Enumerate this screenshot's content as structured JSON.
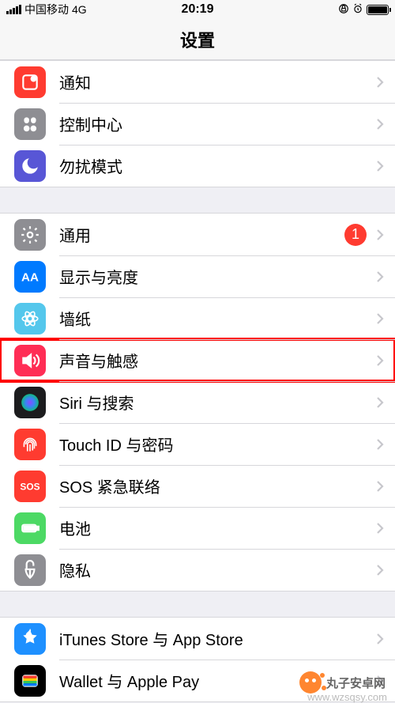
{
  "status": {
    "carrier": "中国移动",
    "network": "4G",
    "time": "20:19"
  },
  "header": {
    "title": "设置"
  },
  "groups": [
    [
      {
        "key": "notifications",
        "label": "通知",
        "bg": "#ff3b30",
        "iconFg": "#fff"
      },
      {
        "key": "control-center",
        "label": "控制中心",
        "bg": "#8e8e93",
        "iconFg": "#fff"
      },
      {
        "key": "dnd",
        "label": "勿扰模式",
        "bg": "#5856d6",
        "iconFg": "#fff"
      }
    ],
    [
      {
        "key": "general",
        "label": "通用",
        "bg": "#8e8e93",
        "iconFg": "#fff",
        "badge": "1"
      },
      {
        "key": "display",
        "label": "显示与亮度",
        "bg": "#007aff",
        "iconFg": "#fff"
      },
      {
        "key": "wallpaper",
        "label": "墙纸",
        "bg": "#54c7ec",
        "iconFg": "#fff"
      },
      {
        "key": "sounds",
        "label": "声音与触感",
        "bg": "#ff2d55",
        "iconFg": "#fff",
        "highlight": true
      },
      {
        "key": "siri",
        "label": "Siri 与搜索",
        "bg": "#1c1c1e",
        "iconFg": "#fff"
      },
      {
        "key": "touchid",
        "label": "Touch ID 与密码",
        "bg": "#ff3b30",
        "iconFg": "#fff"
      },
      {
        "key": "sos",
        "label": "SOS 紧急联络",
        "bg": "#ff3b30",
        "iconFg": "#fff",
        "text": "SOS"
      },
      {
        "key": "battery",
        "label": "电池",
        "bg": "#4cd964",
        "iconFg": "#fff"
      },
      {
        "key": "privacy",
        "label": "隐私",
        "bg": "#8e8e93",
        "iconFg": "#fff"
      }
    ],
    [
      {
        "key": "itunes",
        "label": "iTunes Store 与 App Store",
        "bg": "#1e90ff",
        "iconFg": "#fff"
      },
      {
        "key": "wallet",
        "label": "Wallet 与 Apple Pay",
        "bg": "#000",
        "iconFg": "#fff"
      }
    ]
  ],
  "watermark": {
    "brand": "丸子安卓网",
    "url": "www.wzsqsy.com"
  }
}
